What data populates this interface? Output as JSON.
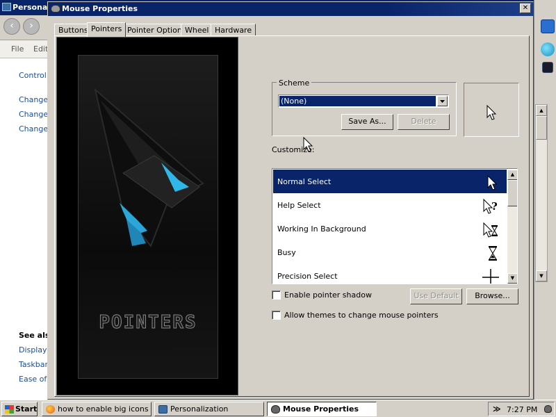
{
  "background_window": {
    "title": "Persona",
    "menu": [
      "File",
      "Edit"
    ],
    "links": [
      "Control",
      "Change",
      "Change",
      "Change"
    ],
    "see_also": "See als",
    "see_also_links": [
      "Display",
      "Taskbar",
      "Ease of"
    ]
  },
  "dialog": {
    "title": "Mouse Properties",
    "close_label": "✕",
    "tabs": [
      "Buttons",
      "Pointers",
      "Pointer Options",
      "Wheel",
      "Hardware"
    ],
    "active_tab": "Pointers",
    "banner_text": "POINTERS",
    "scheme": {
      "label": "Scheme",
      "selected": "(None)",
      "save_as_label": "Save As...",
      "delete_label": "Delete"
    },
    "customize_label": "Customize:",
    "cursor_list": [
      {
        "name": "Normal Select",
        "icon": "arrow-cursor-icon",
        "selected": true
      },
      {
        "name": "Help Select",
        "icon": "help-cursor-icon",
        "selected": false
      },
      {
        "name": "Working In Background",
        "icon": "working-cursor-icon",
        "selected": false
      },
      {
        "name": "Busy",
        "icon": "hourglass-cursor-icon",
        "selected": false
      },
      {
        "name": "Precision Select",
        "icon": "crosshair-cursor-icon",
        "selected": false
      }
    ],
    "enable_shadow_label": "Enable pointer shadow",
    "allow_themes_label": "Allow themes to change mouse pointers",
    "use_default_label": "Use Default",
    "browse_label": "Browse..."
  },
  "taskbar": {
    "start_label": "Start",
    "tasks": [
      {
        "label": "how to enable big icons ...",
        "icon": "firefox-icon",
        "active": false
      },
      {
        "label": "Personalization",
        "icon": "personalization-icon",
        "active": false
      },
      {
        "label": "Mouse Properties",
        "icon": "mouse-icon",
        "active": true
      }
    ],
    "tray_chevron": "≫",
    "clock": "7:27 PM"
  },
  "colors": {
    "titlebar": "#0a246a",
    "selection": "#0a246a",
    "face": "#d4d0c8",
    "link": "#1a4fa0"
  }
}
